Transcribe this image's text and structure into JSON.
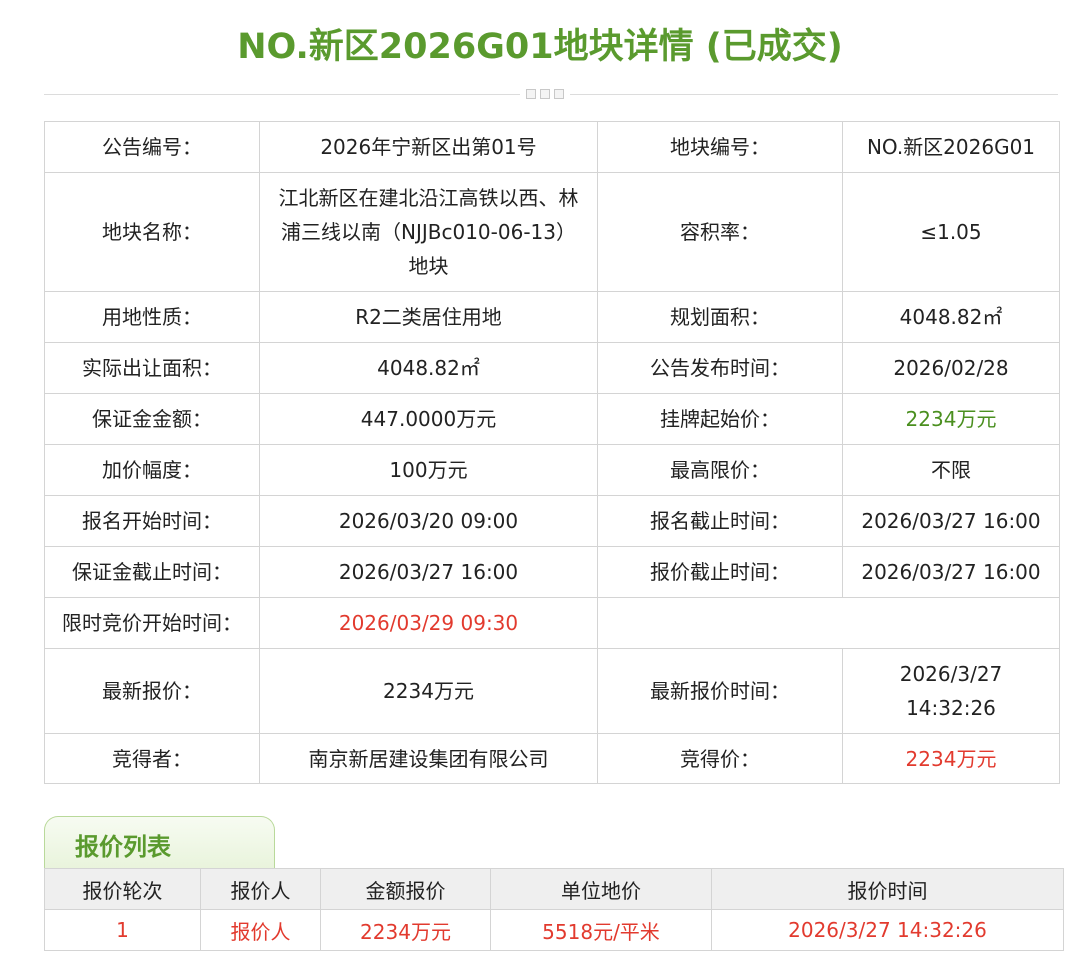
{
  "page": {
    "title": "NO.新区2026G01地块详情 (已成交)"
  },
  "detail": {
    "rows": [
      {
        "l1": "公告编号：",
        "v1": "2026年宁新区出第01号",
        "l2": "地块编号：",
        "v2": "NO.新区2026G01"
      },
      {
        "l1": "地块名称：",
        "v1": "江北新区在建北沿江高铁以西、林浦三线以南（NJJBc010-06-13）地块",
        "l2": "容积率：",
        "v2": "≤1.05"
      },
      {
        "l1": "用地性质：",
        "v1": "R2二类居住用地",
        "l2": "规划面积：",
        "v2": "4048.82㎡"
      },
      {
        "l1": "实际出让面积：",
        "v1": "4048.82㎡",
        "l2": "公告发布时间：",
        "v2": "2026/02/28"
      },
      {
        "l1": "保证金金额：",
        "v1": "447.0000万元",
        "l2": "挂牌起始价：",
        "v2": "2234万元"
      },
      {
        "l1": "加价幅度：",
        "v1": "100万元",
        "l2": "最高限价：",
        "v2": "不限"
      },
      {
        "l1": "报名开始时间：",
        "v1": "2026/03/20 09:00",
        "l2": "报名截止时间：",
        "v2": "2026/03/27 16:00"
      },
      {
        "l1": "保证金截止时间：",
        "v1": "2026/03/27 16:00",
        "l2": "报价截止时间：",
        "v2": "2026/03/27 16:00"
      },
      {
        "l1": "限时竞价开始时间：",
        "v1": "2026/03/29 09:30"
      },
      {
        "l1": "最新报价：",
        "v1": "2234万元",
        "l2": "最新报价时间：",
        "v2": "2026/3/27 14:32:26"
      },
      {
        "l1": "竞得者：",
        "v1": "南京新居建设集团有限公司",
        "l2": "竞得价：",
        "v2": "2234万元"
      }
    ]
  },
  "bids": {
    "tab_label": "报价列表",
    "headers": [
      "报价轮次",
      "报价人",
      "金额报价",
      "单位地价",
      "报价时间"
    ],
    "rows": [
      [
        "1",
        "报价人",
        "2234万元",
        "5518元/平米",
        "2026/3/27 14:32:26"
      ]
    ]
  },
  "colors": {
    "brand_green": "#5a9a2e",
    "price_green": "#4a8f1f",
    "highlight_red": "#e23a2e"
  }
}
